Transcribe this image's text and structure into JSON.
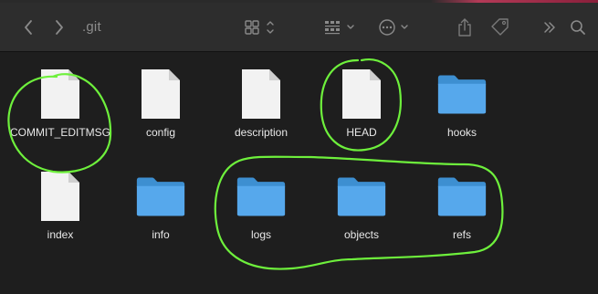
{
  "window": {
    "title": ".git"
  },
  "toolbar": {
    "back": {
      "icon": "chevron-left-icon"
    },
    "forward": {
      "icon": "chevron-right-icon"
    },
    "view_mode": {
      "icon": "icon-grid-view-icon"
    },
    "group_by": {
      "icon": "group-by-icon"
    },
    "action": {
      "icon": "ellipsis-circle-icon"
    },
    "share": {
      "icon": "share-icon"
    },
    "tags": {
      "icon": "tag-icon"
    },
    "more": {
      "icon": "double-chevron-right-icon"
    },
    "search": {
      "icon": "search-icon"
    }
  },
  "files": [
    {
      "name": "COMMIT_EDITMSG",
      "kind": "document",
      "highlighted": true
    },
    {
      "name": "config",
      "kind": "document",
      "highlighted": false
    },
    {
      "name": "description",
      "kind": "document",
      "highlighted": false
    },
    {
      "name": "HEAD",
      "kind": "document",
      "highlighted": true
    },
    {
      "name": "hooks",
      "kind": "folder",
      "highlighted": false
    },
    {
      "name": "index",
      "kind": "document",
      "highlighted": false
    },
    {
      "name": "info",
      "kind": "folder",
      "highlighted": false
    },
    {
      "name": "logs",
      "kind": "folder",
      "highlighted": true
    },
    {
      "name": "objects",
      "kind": "folder",
      "highlighted": true
    },
    {
      "name": "refs",
      "kind": "folder",
      "highlighted": true
    }
  ],
  "colors": {
    "background": "#1e1e1e",
    "toolbar": "#2d2d2d",
    "folder": "#4aa3e6",
    "document": "#f2f2f2",
    "annotation": "#6ef03c"
  }
}
